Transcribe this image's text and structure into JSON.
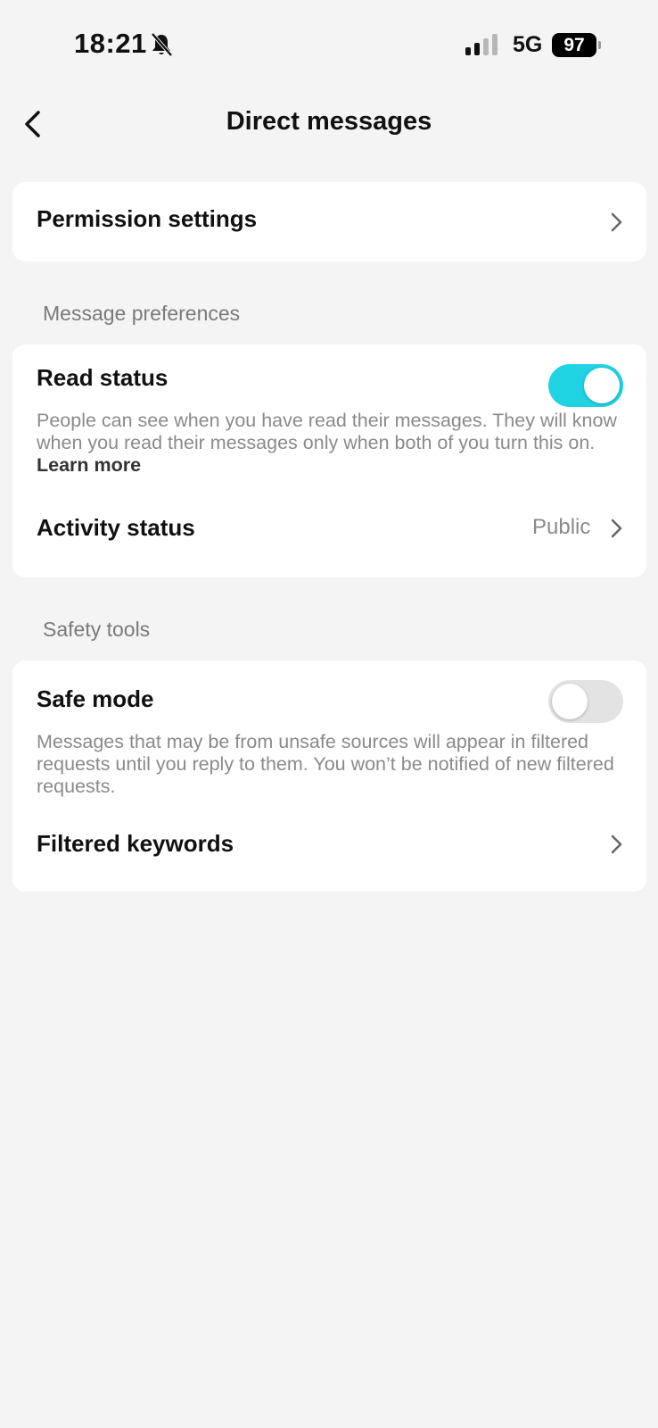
{
  "status_bar": {
    "time": "18:21",
    "network": "5G",
    "battery": "97",
    "accent_colors": {
      "battery": "#000000"
    }
  },
  "nav": {
    "title": "Direct messages",
    "back_icon": "chevron-left-icon"
  },
  "permission_settings": {
    "label": "Permission settings"
  },
  "message_preferences": {
    "header": "Message preferences",
    "read_status": {
      "label": "Read status",
      "enabled": true,
      "description": "People can see when you have read their messages. They will know when you read their messages only when both of you turn this on.",
      "learn_more": "Learn more"
    },
    "activity_status": {
      "label": "Activity status",
      "value": "Public"
    }
  },
  "safety_tools": {
    "header": "Safety tools",
    "safe_mode": {
      "label": "Safe mode",
      "enabled": false,
      "description": "Messages that may be from unsafe sources will appear in filtered requests until you reply to them. You won’t be notified of new filtered requests."
    },
    "filtered_keywords": {
      "label": "Filtered keywords"
    }
  },
  "colors": {
    "toggle_on": "#1fd3e3",
    "toggle_off": "#e3e3e3",
    "background": "#f4f4f4"
  }
}
